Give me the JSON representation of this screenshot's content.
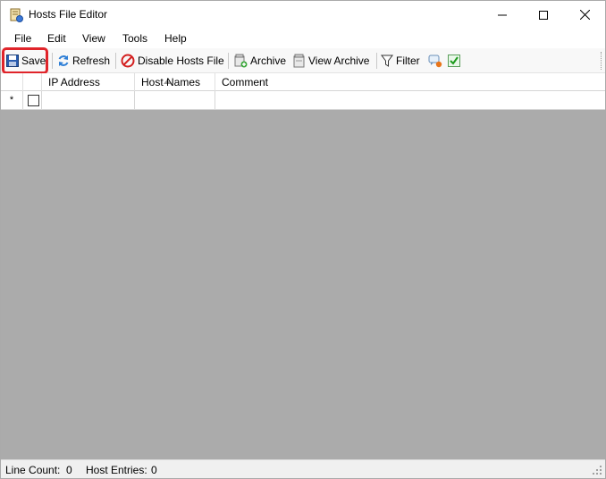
{
  "window": {
    "title": "Hosts File Editor"
  },
  "menu": {
    "items": [
      "File",
      "Edit",
      "View",
      "Tools",
      "Help"
    ]
  },
  "toolbar": {
    "save_label": "Save",
    "refresh_label": "Refresh",
    "disable_label": "Disable Hosts File",
    "archive_label": "Archive",
    "view_archive_label": "View Archive",
    "filter_label": "Filter",
    "highlight_color": "#e0242a"
  },
  "grid": {
    "columns": [
      "IP Address",
      "Host Names",
      "Comment"
    ],
    "new_row_marker": "*",
    "background_color": "#ababab"
  },
  "status": {
    "line_count_label": "Line Count:",
    "line_count_value": "0",
    "host_entries_label": "Host Entries:",
    "host_entries_value": "0"
  }
}
